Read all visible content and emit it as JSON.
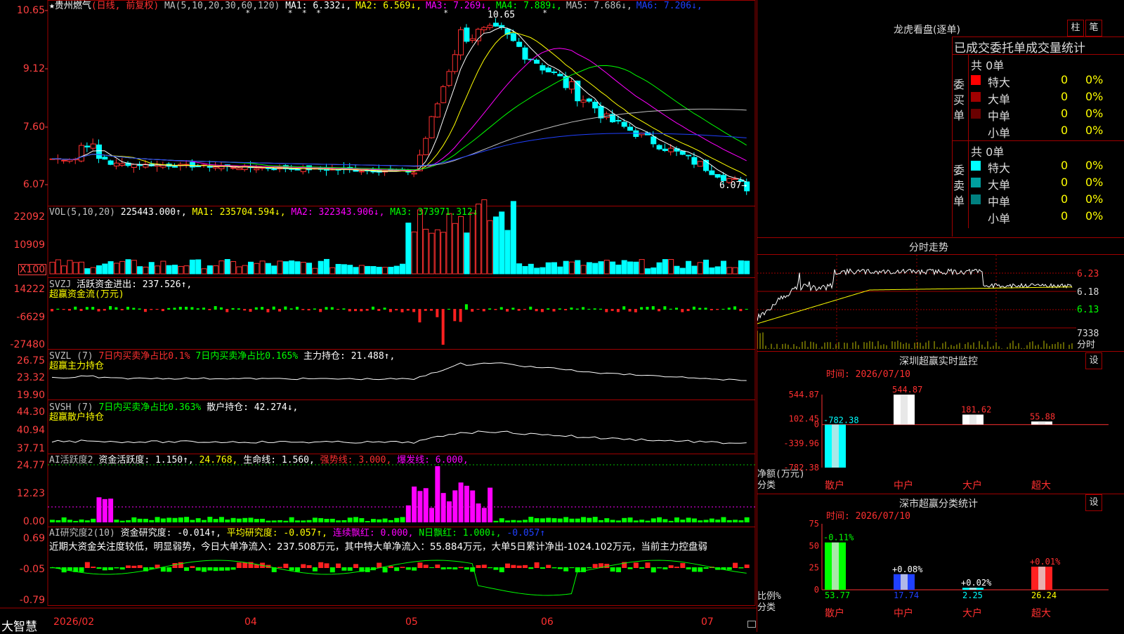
{
  "stock": {
    "star": "★",
    "name": "贵州燃气",
    "period": "(日线, 前复权)"
  },
  "ma_header": {
    "label": "MA(5,10,20,30,60,120)",
    "items": [
      {
        "label": "MA1:",
        "value": "6.332",
        "arrow": "↓",
        "color": "#ffffff"
      },
      {
        "label": "MA2:",
        "value": "6.569",
        "arrow": "↓",
        "color": "#ffff00"
      },
      {
        "label": "MA3:",
        "value": "7.269",
        "arrow": "↓",
        "color": "#ff00ff"
      },
      {
        "label": "MA4:",
        "value": "7.889",
        "arrow": "↓",
        "color": "#00ff00"
      },
      {
        "label": "MA5:",
        "value": "7.686",
        "arrow": "↓",
        "color": "#c0c0c0"
      },
      {
        "label": "MA6:",
        "value": "7.206",
        "arrow": "↓",
        "color": "#2040ff"
      }
    ]
  },
  "price_axis": [
    "10.65",
    "9.12",
    "7.60",
    "6.07"
  ],
  "annotations": {
    "high": "10.65",
    "last": "6.07→",
    "hpos": [
      0.28,
      0.34,
      0.36,
      0.38,
      0.56,
      0.7
    ]
  },
  "vol_header": {
    "label": "VOL(5,10,20)",
    "value": "225443.000↑,",
    "ma1": "MA1: 235704.594↓,",
    "ma2": "MA2: 322343.906↓,",
    "ma3": "MA3: 373971.312↓"
  },
  "vol_axis": [
    "22092",
    "10909",
    "X100"
  ],
  "svzj": {
    "name": "SVZJ",
    "label": "活跃资金进出: 237.526↑,",
    "sub": "超赢资金流(万元)",
    "axis": [
      "14222",
      "-6629",
      "-27480"
    ]
  },
  "svzl": {
    "name": "SVZL (7)",
    "t1": "7日内买卖净占比0.1%",
    "t2": "7日内买卖净占比0.165%",
    "t3": "主力持仓: 21.488↑,",
    "sub": "超赢主力持仓",
    "axis": [
      "26.75",
      "23.32",
      "19.90"
    ]
  },
  "svsh": {
    "name": "SVSH (7)",
    "t1": "7日内买卖净占比0.363%",
    "t2": "散户持仓: 42.274↓,",
    "sub": "超赢散户持仓",
    "axis": [
      "44.30",
      "40.94",
      "37.71"
    ]
  },
  "ai_act": {
    "name": "AI活跃度2",
    "t1": "资金活跃度: 1.150↑,",
    "t2": "24.768,",
    "t3": "生命线: 1.560,",
    "t4": "强势线: 3.000,",
    "t5": "爆发线: 6.000,",
    "axis": [
      "24.77",
      "12.23",
      "0.00"
    ]
  },
  "ai_res": {
    "name": "AI研究度2(10)",
    "t1": "资金研究度: -0.014↑,",
    "t2": "平均研究度: -0.057↑,",
    "t3": "连续飘红: 0.000,",
    "t4": "N日飘红: 1.000↓,",
    "t5": "-0.057↑",
    "comment": "近期大资金关注度较低，明显弱势，今日大单净流入：237.508万元，其中特大单净流入：55.884万元，大单5日累计净出-1024.102万元，当前主力控盘弱",
    "axis": [
      "0.69",
      "-0.05",
      "-0.79"
    ]
  },
  "date_axis": {
    "brand": "大智慧",
    "labels": [
      "2026/02",
      "04",
      "05",
      "06",
      "07"
    ]
  },
  "right_panel": {
    "dragon_title": "龙虎看盘(逐单)",
    "btn_zhu": "柱",
    "btn_bi": "笔",
    "stat_title": "已成交委托单成交量统计",
    "buy_label": "委买单",
    "sell_label": "委卖单",
    "buy_total": "共 0单",
    "sell_total": "共 0单",
    "buy_rows": [
      {
        "name": "特大",
        "count": "0",
        "pct": "0%",
        "color": "#ff0000"
      },
      {
        "name": "大单",
        "count": "0",
        "pct": "0%",
        "color": "#a00000"
      },
      {
        "name": "中单",
        "count": "0",
        "pct": "0%",
        "color": "#6a0000"
      },
      {
        "name": "小单",
        "count": "0",
        "pct": "0%",
        "color": ""
      }
    ],
    "sell_rows": [
      {
        "name": "特大",
        "count": "0",
        "pct": "0%",
        "color": "#00ffff"
      },
      {
        "name": "大单",
        "count": "0",
        "pct": "0%",
        "color": "#00a0a0"
      },
      {
        "name": "中单",
        "count": "0",
        "pct": "0%",
        "color": "#008080"
      },
      {
        "name": "小单",
        "count": "0",
        "pct": "0%",
        "color": ""
      }
    ],
    "intraday_title": "分时走势",
    "intraday_axis": [
      "6.23",
      "6.18",
      "6.13"
    ],
    "intraday_vol": "7338",
    "intraday_fen": "分时",
    "monitor_title": "深圳超赢实时监控",
    "monitor_btn": "设",
    "monitor_time": "时间: 2026/07/10",
    "monitor_axis": [
      "544.87",
      "102.45",
      "0",
      "-339.96",
      "-782.38"
    ],
    "monitor_ylabel": "净额(万元)",
    "monitor_xlabel": "分类",
    "class_title": "深市超赢分类统计",
    "class_btn": "设",
    "class_time": "时间: 2026/07/10",
    "class_axis": [
      "75",
      "50",
      "25",
      "0"
    ],
    "class_ylabel": "比例%",
    "class_xlabel": "分类"
  },
  "chart_data": [
    {
      "type": "bar",
      "title": "深圳超赢实时监控",
      "ylabel": "净额(万元)",
      "xlabel": "分类",
      "categories": [
        "散户",
        "中户",
        "大户",
        "超大"
      ],
      "values": [
        -782.38,
        544.87,
        181.62,
        55.88
      ],
      "colors": [
        "#00ffff",
        "#ffffff",
        "#ffffff",
        "#ffffff"
      ],
      "ylim": [
        -782.38,
        544.87
      ]
    },
    {
      "type": "bar",
      "title": "深市超赢分类统计",
      "ylabel": "比例%",
      "xlabel": "分类",
      "categories": [
        "散户",
        "中户",
        "大户",
        "超大"
      ],
      "values": [
        53.77,
        17.74,
        2.25,
        26.24
      ],
      "changes": [
        "-0.11%",
        "+0.08%",
        "+0.02%",
        "+0.01%"
      ],
      "colors": [
        "#00ff00",
        "#2040ff",
        "#00ffff",
        "#ff2020"
      ],
      "ylim": [
        0,
        75
      ]
    }
  ]
}
